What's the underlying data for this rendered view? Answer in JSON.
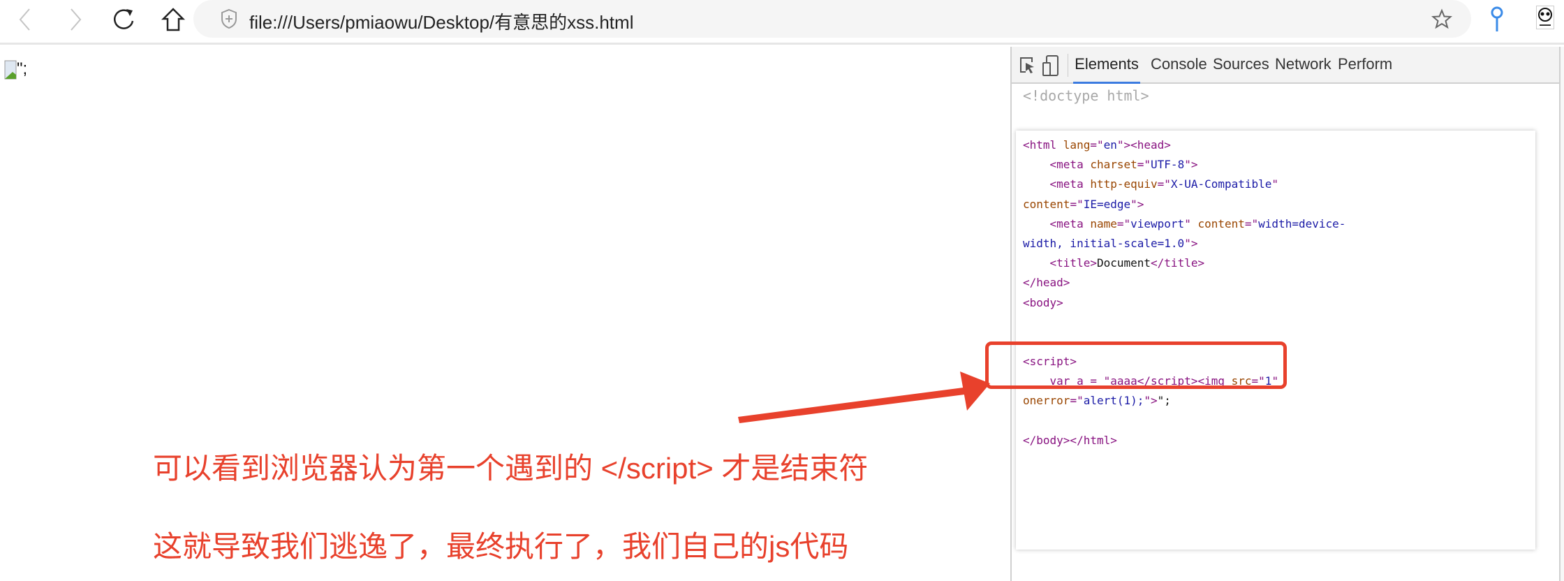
{
  "browser": {
    "url": "file:///Users/pmiaowu/Desktop/有意思的xss.html"
  },
  "page": {
    "rendered_text": "\";"
  },
  "devtools": {
    "tabs": [
      "Elements",
      "Console",
      "Sources",
      "Network",
      "Perform"
    ],
    "active_tab": "Elements",
    "doctype": "<!doctype html>",
    "code_lines": [
      [
        [
          "<html ",
          "tag"
        ],
        [
          "lang",
          "attr"
        ],
        [
          "=\"",
          "tag"
        ],
        [
          "en",
          "val"
        ],
        [
          "\"><head>",
          "tag"
        ]
      ],
      [
        [
          "    <meta ",
          "tag"
        ],
        [
          "charset",
          "attr"
        ],
        [
          "=\"",
          "tag"
        ],
        [
          "UTF-8",
          "val"
        ],
        [
          "\">",
          "tag"
        ]
      ],
      [
        [
          "    <meta ",
          "tag"
        ],
        [
          "http-equiv",
          "attr"
        ],
        [
          "=\"",
          "tag"
        ],
        [
          "X-UA-Compatible",
          "val"
        ],
        [
          "\"",
          "tag"
        ]
      ],
      [
        [
          "content",
          "attr"
        ],
        [
          "=\"",
          "tag"
        ],
        [
          "IE=edge",
          "val"
        ],
        [
          "\">",
          "tag"
        ]
      ],
      [
        [
          "    <meta ",
          "tag"
        ],
        [
          "name",
          "attr"
        ],
        [
          "=\"",
          "tag"
        ],
        [
          "viewport",
          "val"
        ],
        [
          "\" ",
          "tag"
        ],
        [
          "content",
          "attr"
        ],
        [
          "=\"",
          "tag"
        ],
        [
          "width=device-",
          "val"
        ]
      ],
      [
        [
          "width, initial-scale=1.0",
          "val"
        ],
        [
          "\">",
          "tag"
        ]
      ],
      [
        [
          "    <title>",
          "tag"
        ],
        [
          "Document",
          "text"
        ],
        [
          "</title>",
          "tag"
        ]
      ],
      [
        [
          "</head>",
          "tag"
        ]
      ],
      [
        [
          "<body>",
          "tag"
        ]
      ],
      [],
      [],
      [
        [
          "<script>",
          "tag"
        ]
      ],
      [
        [
          "    var a = \"aaaa</script>",
          "tag"
        ],
        [
          "<img ",
          "tag"
        ],
        [
          "src",
          "attr"
        ],
        [
          "=\"",
          "tag"
        ],
        [
          "1",
          "val"
        ],
        [
          "\"",
          "tag"
        ]
      ],
      [
        [
          "onerror",
          "attr"
        ],
        [
          "=\"",
          "tag"
        ],
        [
          "alert(1);",
          "val"
        ],
        [
          "\">",
          "tag"
        ],
        [
          "\";",
          "text"
        ]
      ],
      [],
      [
        [
          "</body></html>",
          "tag"
        ]
      ]
    ]
  },
  "annotations": {
    "line1": "可以看到浏览器认为第一个遇到的 </script> 才是结束符",
    "line2": "这就导致我们逃逸了，最终执行了，我们自己的js代码"
  },
  "colors": {
    "annotation_red": "#e8412c",
    "tab_underline": "#3b7be0"
  }
}
